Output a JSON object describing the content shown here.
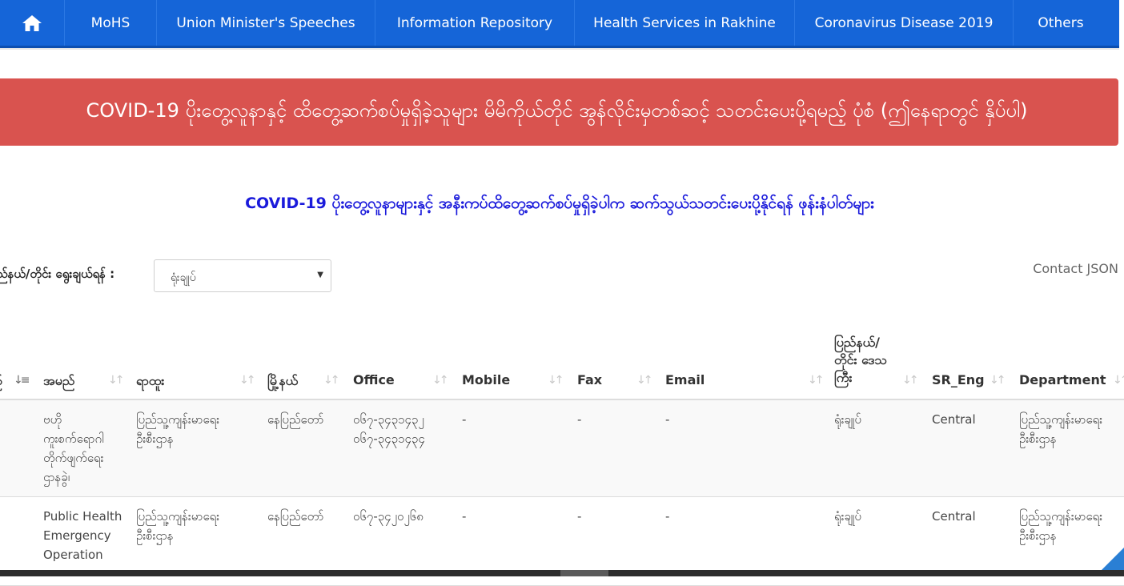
{
  "nav": {
    "home_icon": "home-icon",
    "items": [
      {
        "label": "MoHS"
      },
      {
        "label": "Union Minister's Speeches"
      },
      {
        "label": "Information Repository"
      },
      {
        "label": "Health Services in Rakhine"
      },
      {
        "label": "Coronavirus Disease 2019"
      },
      {
        "label": "Others"
      }
    ]
  },
  "alert": {
    "text": "COVID-19 ပိုးတွေ့လူနာနှင့် ထိတွေ့ဆက်စပ်မှုရှိခဲ့သူများ မိမိကိုယ်တိုင် အွန်လိုင်းမှတစ်ဆင့် သတင်းပေးပို့ရမည့် ပုံစံ (ဤနေရာတွင် နှိပ်ပါ)",
    "color": "#d9534f"
  },
  "subtitle": "COVID-19 ပိုးတွေ့လူနာများနှင့် အနီးကပ်ထိတွေ့ဆက်စပ်မှုရှိခဲ့ပါက ဆက်သွယ်သတင်းပေးပို့နိုင်ရန် ဖုန်းနံပါတ်များ",
  "filter": {
    "label": "ပြည်နယ်/တိုင်း ရွေးချယ်ရန် :",
    "selected": "ရုံးချုပ်"
  },
  "contact_json": "Contact JSON",
  "table": {
    "headers": {
      "first": "ဉ်",
      "name": "အမည်",
      "position": "ရာထူး",
      "city": "မြို့နယ်",
      "office": "Office",
      "mobile": "Mobile",
      "fax": "Fax",
      "email": "Email",
      "region": "ပြည်နယ်/ တိုင်း ဒေသကြီး",
      "sr_eng": "SR_Eng",
      "department": "Department"
    },
    "rows": [
      {
        "name": "ဗဟို ကူးစက်ရောဂါ တိုက်ဖျက်ရေး ဌာနခွဲ၊",
        "position": "ပြည်သူ့ကျန်းမာရေး ဦးစီးဌာန",
        "city": "နေပြည်တော်",
        "office": "၀၆၇-၃၄၃၁၄၃၂ ၀၆၇-၃၄၃၁၄၃၄",
        "mobile": "-",
        "fax": "-",
        "email": "-",
        "region": "ရုံးချုပ်",
        "sr_eng": "Central",
        "department": "ပြည်သူ့ကျန်းမာရေး ဦးစီးဌာန"
      },
      {
        "name": "Public Health Emergency Operation",
        "position": "ပြည်သူ့ကျန်းမာရေး ဦးစီးဌာန",
        "city": "နေပြည်တော်",
        "office": "၀၆၇-၃၄၂၀၂၆၈",
        "mobile": "-",
        "fax": "-",
        "email": "-",
        "region": "ရုံးချုပ်",
        "sr_eng": "Central",
        "department": "ပြည်သူ့ကျန်းမာရေး ဦးစီးဌာန"
      }
    ]
  }
}
